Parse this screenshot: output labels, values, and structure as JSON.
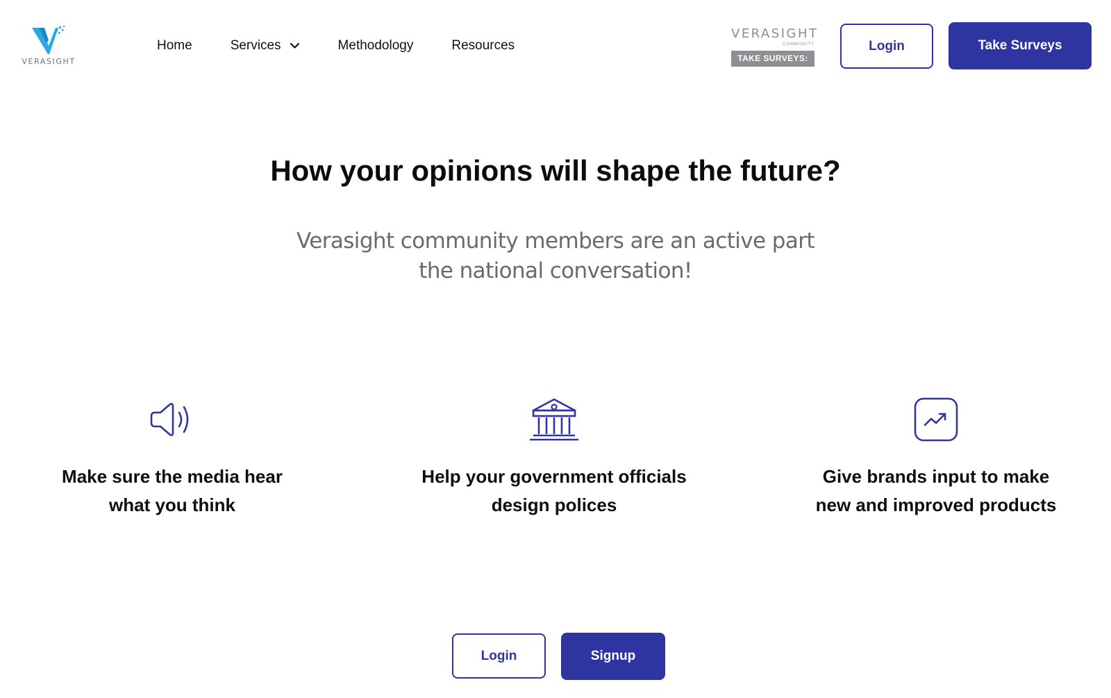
{
  "header": {
    "logo": {
      "text": "VERASIGHT",
      "icon": "verasight-v-logo-icon"
    },
    "nav": [
      {
        "label": "Home"
      },
      {
        "label": "Services",
        "icon": "chevron-down-icon"
      },
      {
        "label": "Methodology"
      },
      {
        "label": "Resources"
      }
    ],
    "community_badge": {
      "name": "VERASIGHT",
      "sub": "COMMUNITY",
      "take": "TAKE SURVEYS:"
    },
    "login_label": "Login",
    "take_surveys_label": "Take Surveys"
  },
  "hero": {
    "title": "How your opinions will shape the future?",
    "subtitle_line1": "Verasight community members are an active part",
    "subtitle_line2": "the national conversation!"
  },
  "features": [
    {
      "icon": "megaphone-icon",
      "line1": "Make sure the media hear",
      "line2": "what you think"
    },
    {
      "icon": "government-building-icon",
      "line1": "Help your government officials",
      "line2": "design polices"
    },
    {
      "icon": "trending-up-icon",
      "line1": "Give brands input to make",
      "line2": "new and improved products"
    }
  ],
  "cta": {
    "login_label": "Login",
    "signup_label": "Signup"
  },
  "colors": {
    "primary": "#2e35a1",
    "logo_blue": "#29a9e0",
    "badge_gray": "#8d8f92",
    "subtitle_gray": "#6a6a6a"
  }
}
